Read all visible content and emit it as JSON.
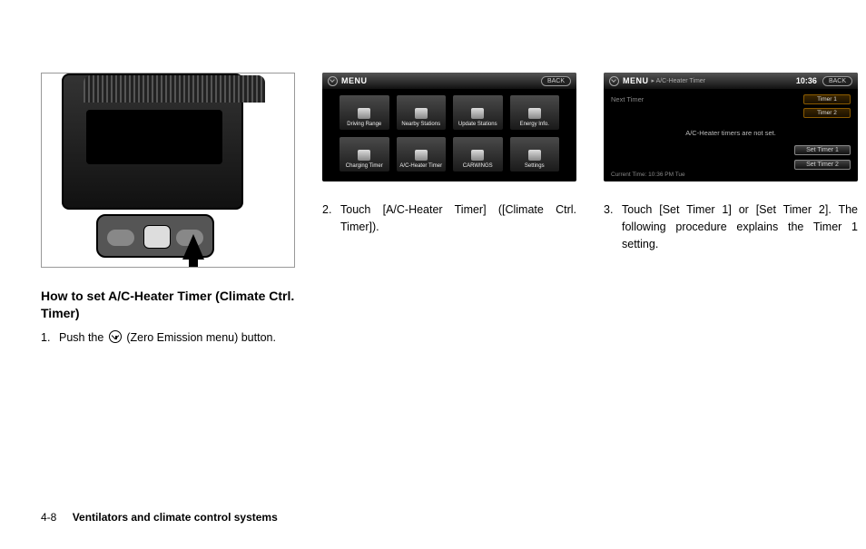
{
  "heading": "How to set A/C-Heater Timer (Climate Ctrl. Timer)",
  "steps": {
    "s1_num": "1.",
    "s1_pre": "Push the ",
    "s1_post": " (Zero Emission menu) button.",
    "s2_num": "2.",
    "s2_text": "Touch [A/C-Heater Timer] ([Climate Ctrl. Timer]).",
    "s3_num": "3.",
    "s3_text": "Touch [Set Timer 1] or [Set Timer 2]. The following procedure explains the Timer 1 setting."
  },
  "screen_menu": {
    "title": "MENU",
    "back": "BACK",
    "items": [
      "Driving Range",
      "Nearby Stations",
      "Update Stations",
      "Energy Info.",
      "Charging Timer",
      "A/C-Heater Timer",
      "CARWINGS",
      "Settings"
    ]
  },
  "screen_timer": {
    "title": "MENU",
    "crumb": "▸ A/C-Heater Timer",
    "clock": "10:36",
    "back": "BACK",
    "next_label": "Next Timer",
    "timer1": "Timer 1",
    "timer2": "Timer 2",
    "message": "A/C-Heater timers are not set.",
    "set1": "Set Timer 1",
    "set2": "Set Timer 2",
    "current": "Current Time: 10:36 PM Tue"
  },
  "footer": {
    "page": "4-8",
    "section": "Ventilators and climate control systems"
  }
}
